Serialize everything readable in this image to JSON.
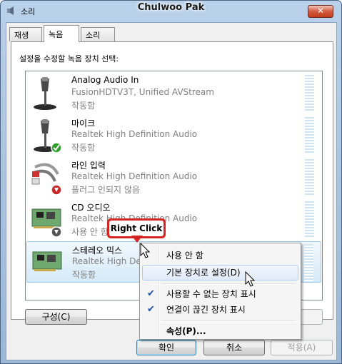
{
  "window": {
    "title": "Chulwoo Pak",
    "app_title": "소리",
    "close_glyph": "✕"
  },
  "tabs": [
    {
      "label": "재생"
    },
    {
      "label": "녹음"
    },
    {
      "label": "소리"
    }
  ],
  "instruction": "설정을 수정할 녹음 장치 선택:",
  "devices": [
    {
      "name": "Analog Audio In",
      "desc": "FusionHDTV3T, Unified AVStream",
      "status": "작동함",
      "icon": "microphone-icon"
    },
    {
      "name": "마이크",
      "desc": "Realtek High Definition Audio",
      "status": "작동함",
      "icon": "microphone-icon",
      "badge": "green-check-badge"
    },
    {
      "name": "라인 입력",
      "desc": "Realtek High Definition Audio",
      "status": "플러그 인되지 않음",
      "icon": "line-in-cable-icon",
      "badge": "red-down-arrow-badge"
    },
    {
      "name": "CD 오디오",
      "desc": "Realtek High Definition Audio",
      "status": "사용 안 함",
      "icon": "sound-card-icon",
      "badge": "disabled-down-arrow-badge"
    },
    {
      "name": "스테레오 믹스",
      "desc": "Realtek High Definition Audio",
      "status": "작동함",
      "icon": "sound-card-icon"
    }
  ],
  "context_menu": {
    "items": [
      {
        "label": "사용 안 함"
      },
      {
        "label": "기본 장치로 설정(D)"
      },
      {
        "label": "사용할 수 없는 장치 표시",
        "checked": true
      },
      {
        "label": "연결이 끊긴 장치 표시",
        "checked": true
      },
      {
        "label": "속성(P)..."
      }
    ],
    "check_glyph": "✔"
  },
  "callout": {
    "text": "Right Click"
  },
  "buttons": {
    "configure": "구성(C)",
    "ok": "확인",
    "cancel": "취소",
    "apply": "적용(A)"
  }
}
